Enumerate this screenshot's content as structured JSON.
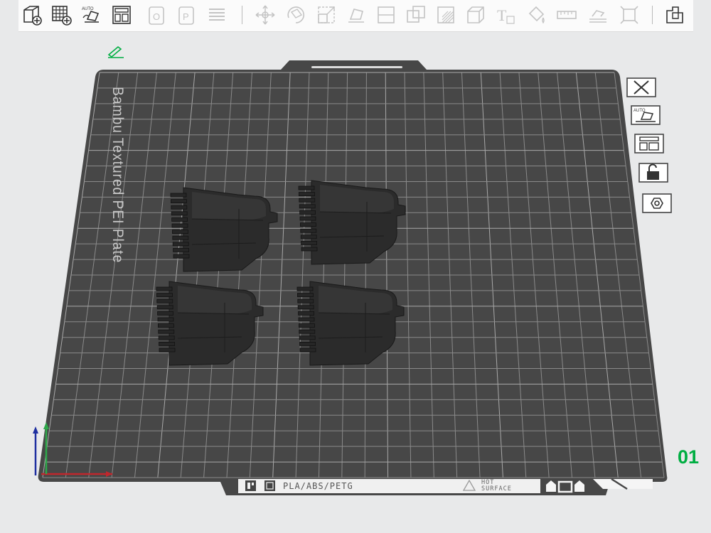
{
  "toolbar": {
    "tools": [
      {
        "name": "add-object-icon",
        "enabled": true
      },
      {
        "name": "add-plate-icon",
        "enabled": true
      },
      {
        "name": "auto-orient-icon",
        "enabled": true,
        "badge": "AUTO"
      },
      {
        "name": "arrange-icon",
        "enabled": true
      },
      {
        "name": "split-objects-icon",
        "enabled": false
      },
      {
        "name": "split-parts-icon",
        "enabled": false
      },
      {
        "name": "layers-icon",
        "enabled": false
      },
      {
        "name": "move-icon",
        "enabled": false
      },
      {
        "name": "rotate-icon",
        "enabled": false
      },
      {
        "name": "scale-icon",
        "enabled": false
      },
      {
        "name": "lay-on-face-icon",
        "enabled": false
      },
      {
        "name": "cut-icon",
        "enabled": false
      },
      {
        "name": "boolean-icon",
        "enabled": false
      },
      {
        "name": "support-paint-icon",
        "enabled": false
      },
      {
        "name": "seam-paint-icon",
        "enabled": false
      },
      {
        "name": "text-icon",
        "enabled": false,
        "badge": "T"
      },
      {
        "name": "color-paint-icon",
        "enabled": false
      },
      {
        "name": "measure-icon",
        "enabled": false
      },
      {
        "name": "assembly-icon",
        "enabled": false
      },
      {
        "name": "simplify-icon",
        "enabled": false
      },
      {
        "name": "assembly-view-icon",
        "enabled": true
      }
    ]
  },
  "plate": {
    "label": "Bambu Textured PEI Plate",
    "index": "01",
    "filament_info": "PLA/ABS/PETG",
    "hot_surface": [
      "HOT",
      "SURFACE"
    ]
  },
  "plate_tools": [
    {
      "name": "delete-plate-icon"
    },
    {
      "name": "auto-orient-plate-icon",
      "badge": "AUTO"
    },
    {
      "name": "arrange-plate-icon"
    },
    {
      "name": "lock-plate-icon"
    },
    {
      "name": "plate-settings-icon"
    }
  ],
  "colors": {
    "background": "#e8e9ea",
    "plate": "#474747",
    "grid": "#8e8e8e",
    "accent": "#00ae42",
    "model": "#2a2a2a"
  }
}
